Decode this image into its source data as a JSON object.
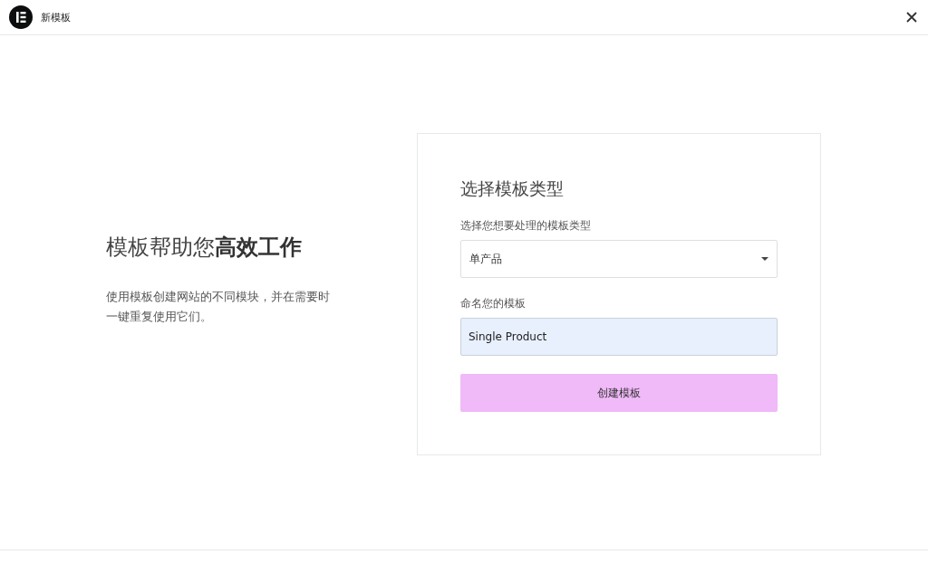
{
  "window": {
    "title": "新模板"
  },
  "intro": {
    "heading": "模板帮助您**高效工作**",
    "description": "使用模板创建网站的不同模块，并在需要时一键重复使用它们。"
  },
  "form": {
    "title": "选择模板类型",
    "type_label": "选择您想要处理的模板类型",
    "type_value": "单产品",
    "name_label": "命名您的模板",
    "name_value": "Single Product",
    "submit": "创建模板"
  }
}
